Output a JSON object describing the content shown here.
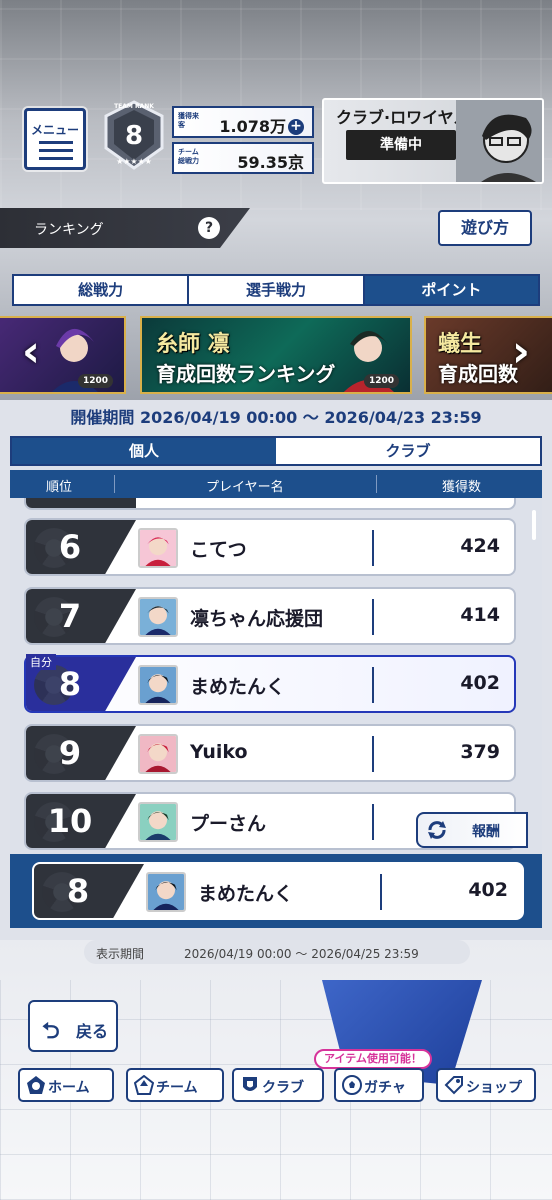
{
  "header": {
    "menu_label": "メニュー",
    "team_rank_label": "TEAM RANK",
    "team_rank_value": "8",
    "stats": [
      {
        "tag": "獲得来客",
        "value": "1.078万"
      },
      {
        "tag": "チーム総戦力",
        "value": "59.35京"
      }
    ],
    "club_royal": {
      "title": "クラブ·ロワイヤル",
      "status": "準備中"
    }
  },
  "ranking_bar": {
    "label": "ランキング",
    "help": "?",
    "howto": "遊び方"
  },
  "tabs": [
    {
      "label": "総戦力",
      "active": false
    },
    {
      "label": "選手戦力",
      "active": false
    },
    {
      "label": "ポイント",
      "active": true
    }
  ],
  "banners": {
    "center_line1": "糸師 凛",
    "center_line2": "育成回数ランキング",
    "badge": "1200",
    "right_line1": "蟻生",
    "right_line2": "育成回数"
  },
  "event_period": "開催期間 2026/04/19 00:00 ～ 2026/04/23 23:59",
  "subtabs": [
    {
      "label": "個人",
      "active": true
    },
    {
      "label": "クラブ",
      "active": false
    }
  ],
  "columns": {
    "rank": "順位",
    "player": "プレイヤー名",
    "score": "獲得数"
  },
  "rows": [
    {
      "rank": "6",
      "name": "こてつ",
      "score": "424",
      "me": false
    },
    {
      "rank": "7",
      "name": "凛ちゃん応援団",
      "score": "414",
      "me": false
    },
    {
      "rank": "8",
      "name": "まめたんく",
      "score": "402",
      "me": true
    },
    {
      "rank": "9",
      "name": "Yuiko",
      "score": "379",
      "me": false
    },
    {
      "rank": "10",
      "name": "プーさん",
      "score": "",
      "me": false
    }
  ],
  "me_tag": "自分",
  "reward_label": "報酬",
  "my_row": {
    "rank": "8",
    "name": "まめたんく",
    "score": "402"
  },
  "display_period": {
    "label": "表示期間",
    "value": "2026/04/19 00:00 ～ 2026/04/25 23:59"
  },
  "back_label": "戻る",
  "nav": [
    {
      "label": "ホーム",
      "icon": "home-icon"
    },
    {
      "label": "チーム",
      "icon": "team-icon"
    },
    {
      "label": "クラブ",
      "icon": "club-icon"
    },
    {
      "label": "ガチャ",
      "icon": "gacha-ball-icon"
    },
    {
      "label": "ショップ",
      "icon": "shop-tag-icon"
    }
  ],
  "item_badge": "アイテム使用可能！",
  "colors": {
    "navy": "#1d3d7c",
    "tab_active": "#1d4f8c",
    "me_accent": "#2a2f9c"
  }
}
